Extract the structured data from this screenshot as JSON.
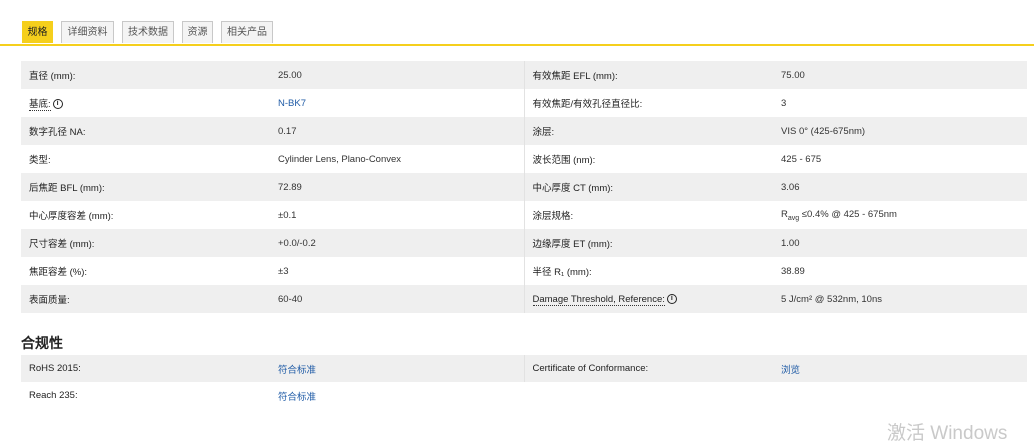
{
  "tabs": [
    {
      "label": "规格"
    },
    {
      "label": "详细资料"
    },
    {
      "label": "技术数据"
    },
    {
      "label": "资源"
    },
    {
      "label": "相关产品"
    }
  ],
  "specs": [
    {
      "l1": "直径 (mm):",
      "v1": "25.00",
      "l2": "有效焦距 EFL (mm):",
      "v2": "75.00"
    },
    {
      "l1": "基底:",
      "v1": "N-BK7",
      "l2": "有效焦距/有效孔径直径比:",
      "v2": "3"
    },
    {
      "l1": "数字孔径 NA:",
      "v1": "0.17",
      "l2": "涂层:",
      "v2": "VIS 0° (425-675nm)"
    },
    {
      "l1": "类型:",
      "v1": "Cylinder Lens, Plano-Convex",
      "l2": "波长范围 (nm):",
      "v2": "425 - 675"
    },
    {
      "l1": "后焦距 BFL (mm):",
      "v1": "72.89",
      "l2": "中心厚度 CT (mm):",
      "v2": "3.06"
    },
    {
      "l1": "中心厚度容差 (mm):",
      "v1": "±0.1",
      "l2": "涂层规格:",
      "v2_r": "R",
      "v2_sub": "avg",
      "v2_rest": " ≤0.4% @ 425 - 675nm"
    },
    {
      "l1": "尺寸容差 (mm):",
      "v1": "+0.0/-0.2",
      "l2": "边缘厚度 ET (mm):",
      "v2": "1.00"
    },
    {
      "l1": "焦距容差 (%):",
      "v1": "±3",
      "l2": "半径 R₁ (mm):",
      "v2": "38.89"
    },
    {
      "l1": "表面质量:",
      "v1": "60-40",
      "l2": "Damage Threshold, Reference:",
      "v2": "5 J/cm² @ 532nm, 10ns"
    }
  ],
  "compliance": {
    "title": "合规性",
    "rows": [
      {
        "l1": "RoHS 2015:",
        "v1": "符合标准",
        "l2": "Certificate of Conformance:",
        "v2": "浏览"
      },
      {
        "l1": "Reach 235:",
        "v1": "符合标准",
        "l2": "",
        "v2": ""
      }
    ]
  },
  "watermark": "激活 Windows"
}
